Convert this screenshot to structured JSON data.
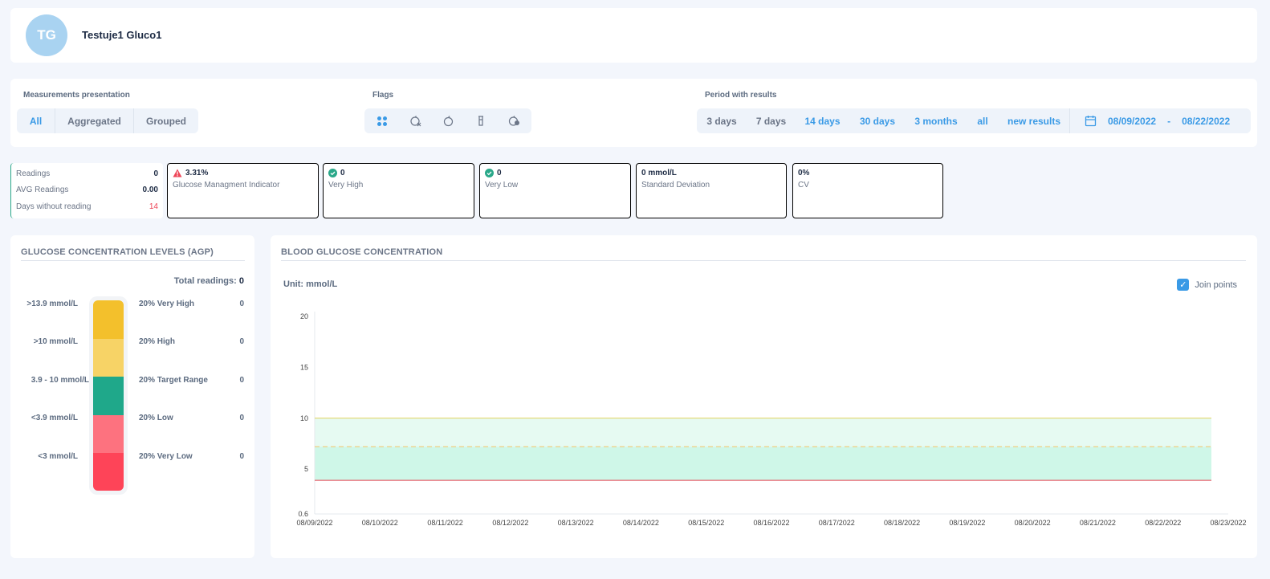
{
  "user": {
    "initials": "TG",
    "name": "Testuje1 Gluco1"
  },
  "measurements": {
    "label": "Measurements presentation",
    "options": [
      "All",
      "Aggregated",
      "Grouped"
    ],
    "active": "All"
  },
  "flags": {
    "label": "Flags",
    "icons": [
      "all-flags-icon",
      "no-meal-icon",
      "before-meal-icon",
      "after-meal-icon",
      "unknown-meal-icon"
    ]
  },
  "period": {
    "label": "Period with results",
    "options": [
      "3 days",
      "7 days",
      "14 days",
      "30 days",
      "3 months",
      "all",
      "new results"
    ],
    "active": "14 days",
    "date_from": "08/09/2022",
    "date_sep": "-",
    "date_to": "08/22/2022"
  },
  "stats": {
    "readings_label": "Readings",
    "readings": "0",
    "avg_label": "AVG Readings",
    "avg": "0.00",
    "days_label": "Days without reading",
    "days": "14"
  },
  "tiles": [
    {
      "value": "3.31%",
      "label": "Glucose Managment Indicator",
      "border": "#ee4658",
      "value_color": "#ee4658",
      "icon": "warning-icon"
    },
    {
      "value": "0",
      "label": "Very High",
      "border": "#2aa889",
      "value_color": "#2aa889",
      "icon": "check-circle-icon"
    },
    {
      "value": "0",
      "label": "Very Low",
      "border": "#2aa889",
      "value_color": "#2aa889",
      "icon": "check-circle-icon"
    },
    {
      "value": "0 mmol/L",
      "label": "Standard Deviation",
      "border": "#000000",
      "value_color": "#1d2b44",
      "icon": ""
    },
    {
      "value": "0%",
      "label": "CV",
      "border": "#000000",
      "value_color": "#1d2b44",
      "icon": ""
    }
  ],
  "agp": {
    "title": "GLUCOSE CONCENTRATION LEVELS (AGP)",
    "total_label": "Total readings:",
    "total": "0",
    "rows": [
      {
        "threshold": ">13.9 mmol/L",
        "label": "20% Very High",
        "count": "0",
        "color": "#f3c02c"
      },
      {
        "threshold": ">10 mmol/L",
        "label": "20% High",
        "count": "0",
        "color": "#f7d366"
      },
      {
        "threshold": "3.9 - 10 mmol/L",
        "label": "20% Target Range",
        "count": "0",
        "color": "#1fa88a"
      },
      {
        "threshold": "<3.9 mmol/L",
        "label": "20% Low",
        "count": "0",
        "color": "#fd727f"
      },
      {
        "threshold": "<3 mmol/L",
        "label": "20% Very Low",
        "count": "0",
        "color": "#fe4458"
      }
    ]
  },
  "bgc": {
    "title": "BLOOD GLUCOSE CONCENTRATION",
    "unit": "Unit: mmol/L",
    "join_label": "Join points",
    "join_checked": true
  },
  "chart_data": {
    "type": "line",
    "title": "",
    "xlabel": "",
    "ylabel": "",
    "x": [
      "08/09/2022",
      "08/10/2022",
      "08/11/2022",
      "08/12/2022",
      "08/13/2022",
      "08/14/2022",
      "08/15/2022",
      "08/16/2022",
      "08/17/2022",
      "08/18/2022",
      "08/19/2022",
      "08/20/2022",
      "08/21/2022",
      "08/22/2022",
      "08/23/2022"
    ],
    "series": [],
    "ylim": [
      0.6,
      20
    ],
    "yticks": [
      "20",
      "15",
      "10",
      "5",
      "0.6"
    ],
    "ytick_values": [
      20,
      15,
      10,
      5,
      0.6
    ],
    "bands": [
      {
        "from": 7.2,
        "to": 10,
        "color": "#e6faf2"
      },
      {
        "from": 3.9,
        "to": 7.2,
        "color": "#cff7e8"
      }
    ],
    "reference_lines": [
      {
        "y": 10,
        "color": "#e0d25a",
        "style": "solid"
      },
      {
        "y": 7.2,
        "color": "#f4c56a",
        "style": "dashed"
      },
      {
        "y": 3.9,
        "color": "#e04650",
        "style": "solid"
      }
    ],
    "grid": false
  }
}
